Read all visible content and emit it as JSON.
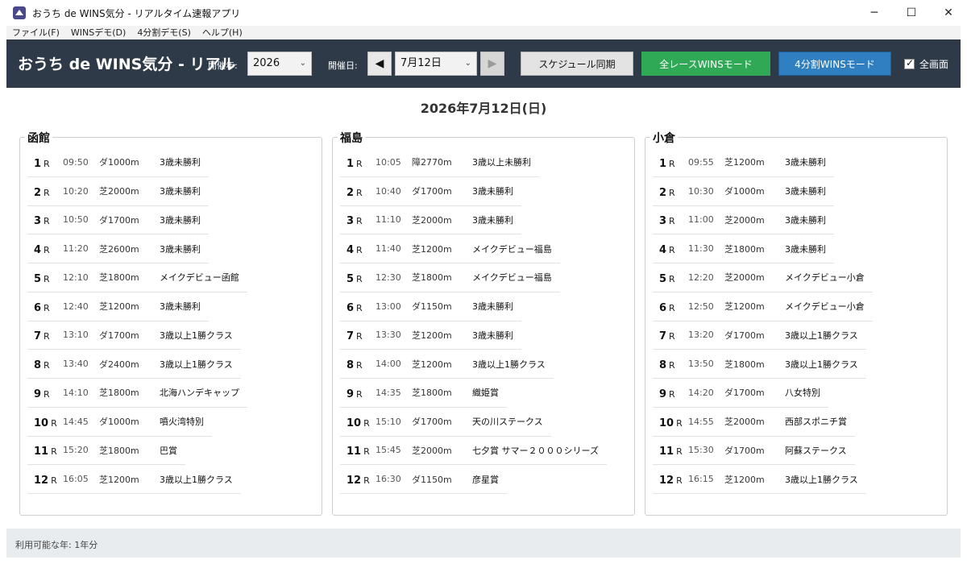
{
  "window": {
    "title": "おうち de WINS気分 - リアルタイム速報アプリ",
    "controls": [
      "─",
      "☐",
      "✕"
    ]
  },
  "menu": [
    "ファイル(F)",
    "WINSデモ(D)",
    "4分割デモ(S)",
    "ヘルプ(H)"
  ],
  "header": {
    "title": "おうち de WINS気分 - リアル",
    "year_label": "開催年:",
    "year_value": "2026",
    "date_label": "開催日:",
    "date_value": "7月12日",
    "prev_glyph": "◀",
    "next_glyph": "▶",
    "sync_label": "スケジュール同期",
    "all_wins_label": "全レースWINSモード",
    "four_split_label": "4分割WINSモード",
    "fullscreen_label": "全画面",
    "fullscreen_checked": true,
    "colors": {
      "header_bg": "#2e3a48",
      "all_wins": "#30a956",
      "four_split": "#2f7fc1"
    }
  },
  "date_heading": "2026年7月12日(日)",
  "venues": [
    {
      "name": "函館",
      "races": [
        {
          "num": "1",
          "r": "R",
          "time": "09:50",
          "course": "ダ1000m",
          "name": "3歳未勝利"
        },
        {
          "num": "2",
          "r": "R",
          "time": "10:20",
          "course": "芝2000m",
          "name": "3歳未勝利"
        },
        {
          "num": "3",
          "r": "R",
          "time": "10:50",
          "course": "ダ1700m",
          "name": "3歳未勝利"
        },
        {
          "num": "4",
          "r": "R",
          "time": "11:20",
          "course": "芝2600m",
          "name": "3歳未勝利"
        },
        {
          "num": "5",
          "r": "R",
          "time": "12:10",
          "course": "芝1800m",
          "name": "メイクデビュー函館"
        },
        {
          "num": "6",
          "r": "R",
          "time": "12:40",
          "course": "芝1200m",
          "name": "3歳未勝利"
        },
        {
          "num": "7",
          "r": "R",
          "time": "13:10",
          "course": "ダ1700m",
          "name": "3歳以上1勝クラス"
        },
        {
          "num": "8",
          "r": "R",
          "time": "13:40",
          "course": "ダ2400m",
          "name": "3歳以上1勝クラス"
        },
        {
          "num": "9",
          "r": "R",
          "time": "14:10",
          "course": "芝1800m",
          "name": "北海ハンデキャップ"
        },
        {
          "num": "10",
          "r": "R",
          "time": "14:45",
          "course": "ダ1000m",
          "name": "噴火湾特別"
        },
        {
          "num": "11",
          "r": "R",
          "time": "15:20",
          "course": "芝1800m",
          "name": "巴賞"
        },
        {
          "num": "12",
          "r": "R",
          "time": "16:05",
          "course": "芝1200m",
          "name": "3歳以上1勝クラス"
        }
      ]
    },
    {
      "name": "福島",
      "races": [
        {
          "num": "1",
          "r": "R",
          "time": "10:05",
          "course": "障2770m",
          "name": "3歳以上未勝利"
        },
        {
          "num": "2",
          "r": "R",
          "time": "10:40",
          "course": "ダ1700m",
          "name": "3歳未勝利"
        },
        {
          "num": "3",
          "r": "R",
          "time": "11:10",
          "course": "芝2000m",
          "name": "3歳未勝利"
        },
        {
          "num": "4",
          "r": "R",
          "time": "11:40",
          "course": "芝1200m",
          "name": "メイクデビュー福島"
        },
        {
          "num": "5",
          "r": "R",
          "time": "12:30",
          "course": "芝1800m",
          "name": "メイクデビュー福島"
        },
        {
          "num": "6",
          "r": "R",
          "time": "13:00",
          "course": "ダ1150m",
          "name": "3歳未勝利"
        },
        {
          "num": "7",
          "r": "R",
          "time": "13:30",
          "course": "芝1200m",
          "name": "3歳未勝利"
        },
        {
          "num": "8",
          "r": "R",
          "time": "14:00",
          "course": "芝1200m",
          "name": "3歳以上1勝クラス"
        },
        {
          "num": "9",
          "r": "R",
          "time": "14:35",
          "course": "芝1800m",
          "name": "織姫賞"
        },
        {
          "num": "10",
          "r": "R",
          "time": "15:10",
          "course": "ダ1700m",
          "name": "天の川ステークス"
        },
        {
          "num": "11",
          "r": "R",
          "time": "15:45",
          "course": "芝2000m",
          "name": "七夕賞 サマー２０００シリーズ"
        },
        {
          "num": "12",
          "r": "R",
          "time": "16:30",
          "course": "ダ1150m",
          "name": "彦星賞"
        }
      ]
    },
    {
      "name": "小倉",
      "races": [
        {
          "num": "1",
          "r": "R",
          "time": "09:55",
          "course": "芝1200m",
          "name": "3歳未勝利"
        },
        {
          "num": "2",
          "r": "R",
          "time": "10:30",
          "course": "ダ1000m",
          "name": "3歳未勝利"
        },
        {
          "num": "3",
          "r": "R",
          "time": "11:00",
          "course": "芝2000m",
          "name": "3歳未勝利"
        },
        {
          "num": "4",
          "r": "R",
          "time": "11:30",
          "course": "芝1800m",
          "name": "3歳未勝利"
        },
        {
          "num": "5",
          "r": "R",
          "time": "12:20",
          "course": "芝2000m",
          "name": "メイクデビュー小倉"
        },
        {
          "num": "6",
          "r": "R",
          "time": "12:50",
          "course": "芝1200m",
          "name": "メイクデビュー小倉"
        },
        {
          "num": "7",
          "r": "R",
          "time": "13:20",
          "course": "ダ1700m",
          "name": "3歳以上1勝クラス"
        },
        {
          "num": "8",
          "r": "R",
          "time": "13:50",
          "course": "芝1800m",
          "name": "3歳以上1勝クラス"
        },
        {
          "num": "9",
          "r": "R",
          "time": "14:20",
          "course": "ダ1700m",
          "name": "八女特別"
        },
        {
          "num": "10",
          "r": "R",
          "time": "14:55",
          "course": "芝2000m",
          "name": "西部スポニチ賞"
        },
        {
          "num": "11",
          "r": "R",
          "time": "15:30",
          "course": "ダ1700m",
          "name": "阿蘇ステークス"
        },
        {
          "num": "12",
          "r": "R",
          "time": "16:15",
          "course": "芝1200m",
          "name": "3歳以上1勝クラス"
        }
      ]
    }
  ],
  "status": "利用可能な年: 1年分"
}
